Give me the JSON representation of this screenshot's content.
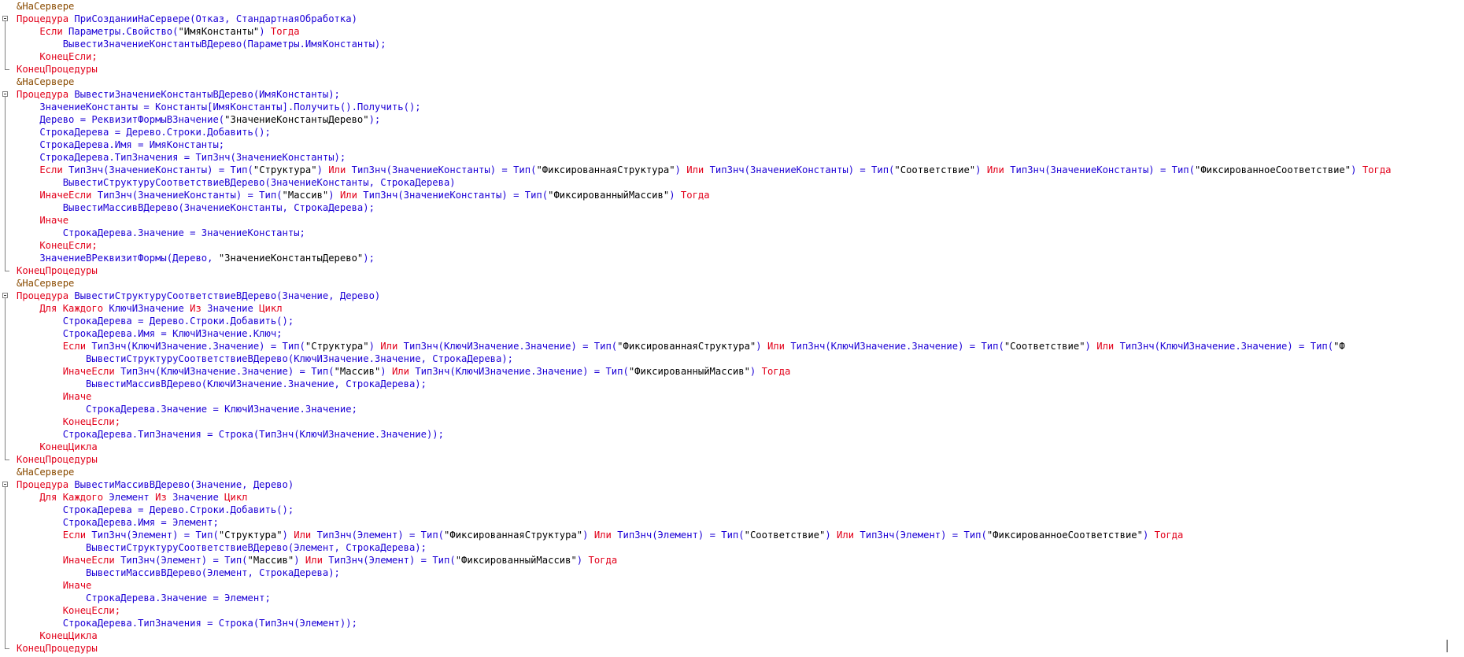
{
  "editor": {
    "lines": [
      [
        [
          "d",
          "&НаСервере"
        ]
      ],
      [
        [
          "k",
          "Процедура "
        ],
        [
          "i",
          "ПриСозданииНаСервере(Отказ, СтандартнаяОбработка)"
        ]
      ],
      [
        [
          "k",
          "    Если "
        ],
        [
          "i",
          "Параметры.Свойство("
        ],
        [
          "s",
          "\"ИмяКонстанты\""
        ],
        [
          "i",
          ") "
        ],
        [
          "k",
          "Тогда"
        ]
      ],
      [
        [
          "i",
          "        ВывестиЗначениеКонстантыВДерево(Параметры.ИмяКонстанты);"
        ]
      ],
      [
        [
          "k",
          "    КонецЕсли;"
        ]
      ],
      [
        [
          "k",
          "КонецПроцедуры"
        ]
      ],
      [
        [
          "d",
          "&НаСервере"
        ]
      ],
      [
        [
          "k",
          "Процедура "
        ],
        [
          "i",
          "ВывестиЗначениеКонстантыВДерево(ИмяКонстанты);"
        ]
      ],
      [
        [
          "i",
          "    ЗначениеКонстанты = Константы[ИмяКонстанты].Получить().Получить();"
        ]
      ],
      [
        [
          "i",
          "    Дерево = РеквизитФормыВЗначение("
        ],
        [
          "s",
          "\"ЗначениеКонстантыДерево\""
        ],
        [
          "i",
          ");"
        ]
      ],
      [
        [
          "i",
          "    СтрокаДерева = Дерево.Строки.Добавить();"
        ]
      ],
      [
        [
          "i",
          "    СтрокаДерева.Имя = ИмяКонстанты;"
        ]
      ],
      [
        [
          "i",
          "    СтрокаДерева.ТипЗначения = ТипЗнч(ЗначениеКонстанты);"
        ]
      ],
      [
        [
          "k",
          "    Если "
        ],
        [
          "i",
          "ТипЗнч(ЗначениеКонстанты) = Тип("
        ],
        [
          "s",
          "\"Структура\""
        ],
        [
          "i",
          ") "
        ],
        [
          "k",
          "Или "
        ],
        [
          "i",
          "ТипЗнч(ЗначениеКонстанты) = Тип("
        ],
        [
          "s",
          "\"ФиксированнаяСтруктура\""
        ],
        [
          "i",
          ") "
        ],
        [
          "k",
          "Или "
        ],
        [
          "i",
          "ТипЗнч(ЗначениеКонстанты) = Тип("
        ],
        [
          "s",
          "\"Соответствие\""
        ],
        [
          "i",
          ") "
        ],
        [
          "k",
          "Или "
        ],
        [
          "i",
          "ТипЗнч(ЗначениеКонстанты) = Тип("
        ],
        [
          "s",
          "\"ФиксированноеСоответствие\""
        ],
        [
          "i",
          ") "
        ],
        [
          "k",
          "Тогда"
        ]
      ],
      [
        [
          "i",
          "        ВывестиСтруктуруСоответствиеВДерево(ЗначениеКонстанты, СтрокаДерева)"
        ]
      ],
      [
        [
          "k",
          "    ИначеЕсли "
        ],
        [
          "i",
          "ТипЗнч(ЗначениеКонстанты) = Тип("
        ],
        [
          "s",
          "\"Массив\""
        ],
        [
          "i",
          ") "
        ],
        [
          "k",
          "Или "
        ],
        [
          "i",
          "ТипЗнч(ЗначениеКонстанты) = Тип("
        ],
        [
          "s",
          "\"ФиксированныйМассив\""
        ],
        [
          "i",
          ") "
        ],
        [
          "k",
          "Тогда"
        ]
      ],
      [
        [
          "i",
          "        ВывестиМассивВДерево(ЗначениеКонстанты, СтрокаДерева);"
        ]
      ],
      [
        [
          "k",
          "    Иначе"
        ]
      ],
      [
        [
          "i",
          "        СтрокаДерева.Значение = ЗначениеКонстанты;"
        ]
      ],
      [
        [
          "k",
          "    КонецЕсли;"
        ]
      ],
      [
        [
          "i",
          "    ЗначениеВРеквизитФормы(Дерево, "
        ],
        [
          "s",
          "\"ЗначениеКонстантыДерево\""
        ],
        [
          "i",
          ");"
        ]
      ],
      [
        [
          "k",
          "КонецПроцедуры"
        ]
      ],
      [
        [
          "d",
          "&НаСервере"
        ]
      ],
      [
        [
          "k",
          "Процедура "
        ],
        [
          "i",
          "ВывестиСтруктуруСоответствиеВДерево(Значение, Дерево)"
        ]
      ],
      [
        [
          "k",
          "    Для Каждого "
        ],
        [
          "i",
          "КлючИЗначение "
        ],
        [
          "k",
          "Из "
        ],
        [
          "i",
          "Значение "
        ],
        [
          "k",
          "Цикл"
        ]
      ],
      [
        [
          "i",
          "        СтрокаДерева = Дерево.Строки.Добавить();"
        ]
      ],
      [
        [
          "i",
          "        СтрокаДерева.Имя = КлючИЗначение.Ключ;"
        ]
      ],
      [
        [
          "k",
          "        Если "
        ],
        [
          "i",
          "ТипЗнч(КлючИЗначение.Значение) = Тип("
        ],
        [
          "s",
          "\"Структура\""
        ],
        [
          "i",
          ") "
        ],
        [
          "k",
          "Или "
        ],
        [
          "i",
          "ТипЗнч(КлючИЗначение.Значение) = Тип("
        ],
        [
          "s",
          "\"ФиксированнаяСтруктура\""
        ],
        [
          "i",
          ") "
        ],
        [
          "k",
          "Или "
        ],
        [
          "i",
          "ТипЗнч(КлючИЗначение.Значение) = Тип("
        ],
        [
          "s",
          "\"Соответствие\""
        ],
        [
          "i",
          ") "
        ],
        [
          "k",
          "Или "
        ],
        [
          "i",
          "ТипЗнч(КлючИЗначение.Значение) = Тип("
        ],
        [
          "s",
          "\"Ф"
        ]
      ],
      [
        [
          "i",
          "            ВывестиСтруктуруСоответствиеВДерево(КлючИЗначение.Значение, СтрокаДерева);"
        ]
      ],
      [
        [
          "k",
          "        ИначеЕсли "
        ],
        [
          "i",
          "ТипЗнч(КлючИЗначение.Значение) = Тип("
        ],
        [
          "s",
          "\"Массив\""
        ],
        [
          "i",
          ") "
        ],
        [
          "k",
          "Или "
        ],
        [
          "i",
          "ТипЗнч(КлючИЗначение.Значение) = Тип("
        ],
        [
          "s",
          "\"ФиксированныйМассив\""
        ],
        [
          "i",
          ") "
        ],
        [
          "k",
          "Тогда"
        ]
      ],
      [
        [
          "i",
          "            ВывестиМассивВДерево(КлючИЗначение.Значение, СтрокаДерева);"
        ]
      ],
      [
        [
          "k",
          "        Иначе"
        ]
      ],
      [
        [
          "i",
          "            СтрокаДерева.Значение = КлючИЗначение.Значение;"
        ]
      ],
      [
        [
          "k",
          "        КонецЕсли;"
        ]
      ],
      [
        [
          "i",
          "        СтрокаДерева.ТипЗначения = Строка(ТипЗнч(КлючИЗначение.Значение));"
        ]
      ],
      [
        [
          "k",
          "    КонецЦикла"
        ]
      ],
      [
        [
          "k",
          "КонецПроцедуры"
        ]
      ],
      [
        [
          "d",
          "&НаСервере"
        ]
      ],
      [
        [
          "k",
          "Процедура "
        ],
        [
          "i",
          "ВывестиМассивВДерево(Значение, Дерево)"
        ]
      ],
      [
        [
          "k",
          "    Для Каждого "
        ],
        [
          "i",
          "Элемент "
        ],
        [
          "k",
          "Из "
        ],
        [
          "i",
          "Значение "
        ],
        [
          "k",
          "Цикл"
        ]
      ],
      [
        [
          "i",
          "        СтрокаДерева = Дерево.Строки.Добавить();"
        ]
      ],
      [
        [
          "i",
          "        СтрокаДерева.Имя = Элемент;"
        ]
      ],
      [
        [
          "k",
          "        Если "
        ],
        [
          "i",
          "ТипЗнч(Элемент) = Тип("
        ],
        [
          "s",
          "\"Структура\""
        ],
        [
          "i",
          ") "
        ],
        [
          "k",
          "Или "
        ],
        [
          "i",
          "ТипЗнч(Элемент) = Тип("
        ],
        [
          "s",
          "\"ФиксированнаяСтруктура\""
        ],
        [
          "i",
          ") "
        ],
        [
          "k",
          "Или "
        ],
        [
          "i",
          "ТипЗнч(Элемент) = Тип("
        ],
        [
          "s",
          "\"Соответствие\""
        ],
        [
          "i",
          ") "
        ],
        [
          "k",
          "Или "
        ],
        [
          "i",
          "ТипЗнч(Элемент) = Тип("
        ],
        [
          "s",
          "\"ФиксированноеСоответствие\""
        ],
        [
          "i",
          ") "
        ],
        [
          "k",
          "Тогда"
        ]
      ],
      [
        [
          "i",
          "            ВывестиСтруктуруСоответствиеВДерево(Элемент, СтрокаДерева);"
        ]
      ],
      [
        [
          "k",
          "        ИначеЕсли "
        ],
        [
          "i",
          "ТипЗнч(Элемент) = Тип("
        ],
        [
          "s",
          "\"Массив\""
        ],
        [
          "i",
          ") "
        ],
        [
          "k",
          "Или "
        ],
        [
          "i",
          "ТипЗнч(Элемент) = Тип("
        ],
        [
          "s",
          "\"ФиксированныйМассив\""
        ],
        [
          "i",
          ") "
        ],
        [
          "k",
          "Тогда"
        ]
      ],
      [
        [
          "i",
          "            ВывестиМассивВДерево(Элемент, СтрокаДерева);"
        ]
      ],
      [
        [
          "k",
          "        Иначе"
        ]
      ],
      [
        [
          "i",
          "            СтрокаДерева.Значение = Элемент;"
        ]
      ],
      [
        [
          "k",
          "        КонецЕсли;"
        ]
      ],
      [
        [
          "i",
          "        СтрокаДерева.ТипЗначения = Строка(ТипЗнч(Элемент));"
        ]
      ],
      [
        [
          "k",
          "    КонецЦикла"
        ]
      ],
      [
        [
          "k",
          "КонецПроцедуры"
        ]
      ]
    ],
    "folds": [
      [
        1,
        5
      ],
      [
        7,
        21
      ],
      [
        23,
        36
      ],
      [
        38,
        51
      ]
    ]
  },
  "colors": {
    "keyword": "#e2001a",
    "identifier": "#1b00d6",
    "string": "#000000",
    "directive": "#8a4b00",
    "background": "#ffffff"
  },
  "icons": {
    "fold_marker": "collapse-box-icon",
    "caret": "text-cursor-icon"
  }
}
